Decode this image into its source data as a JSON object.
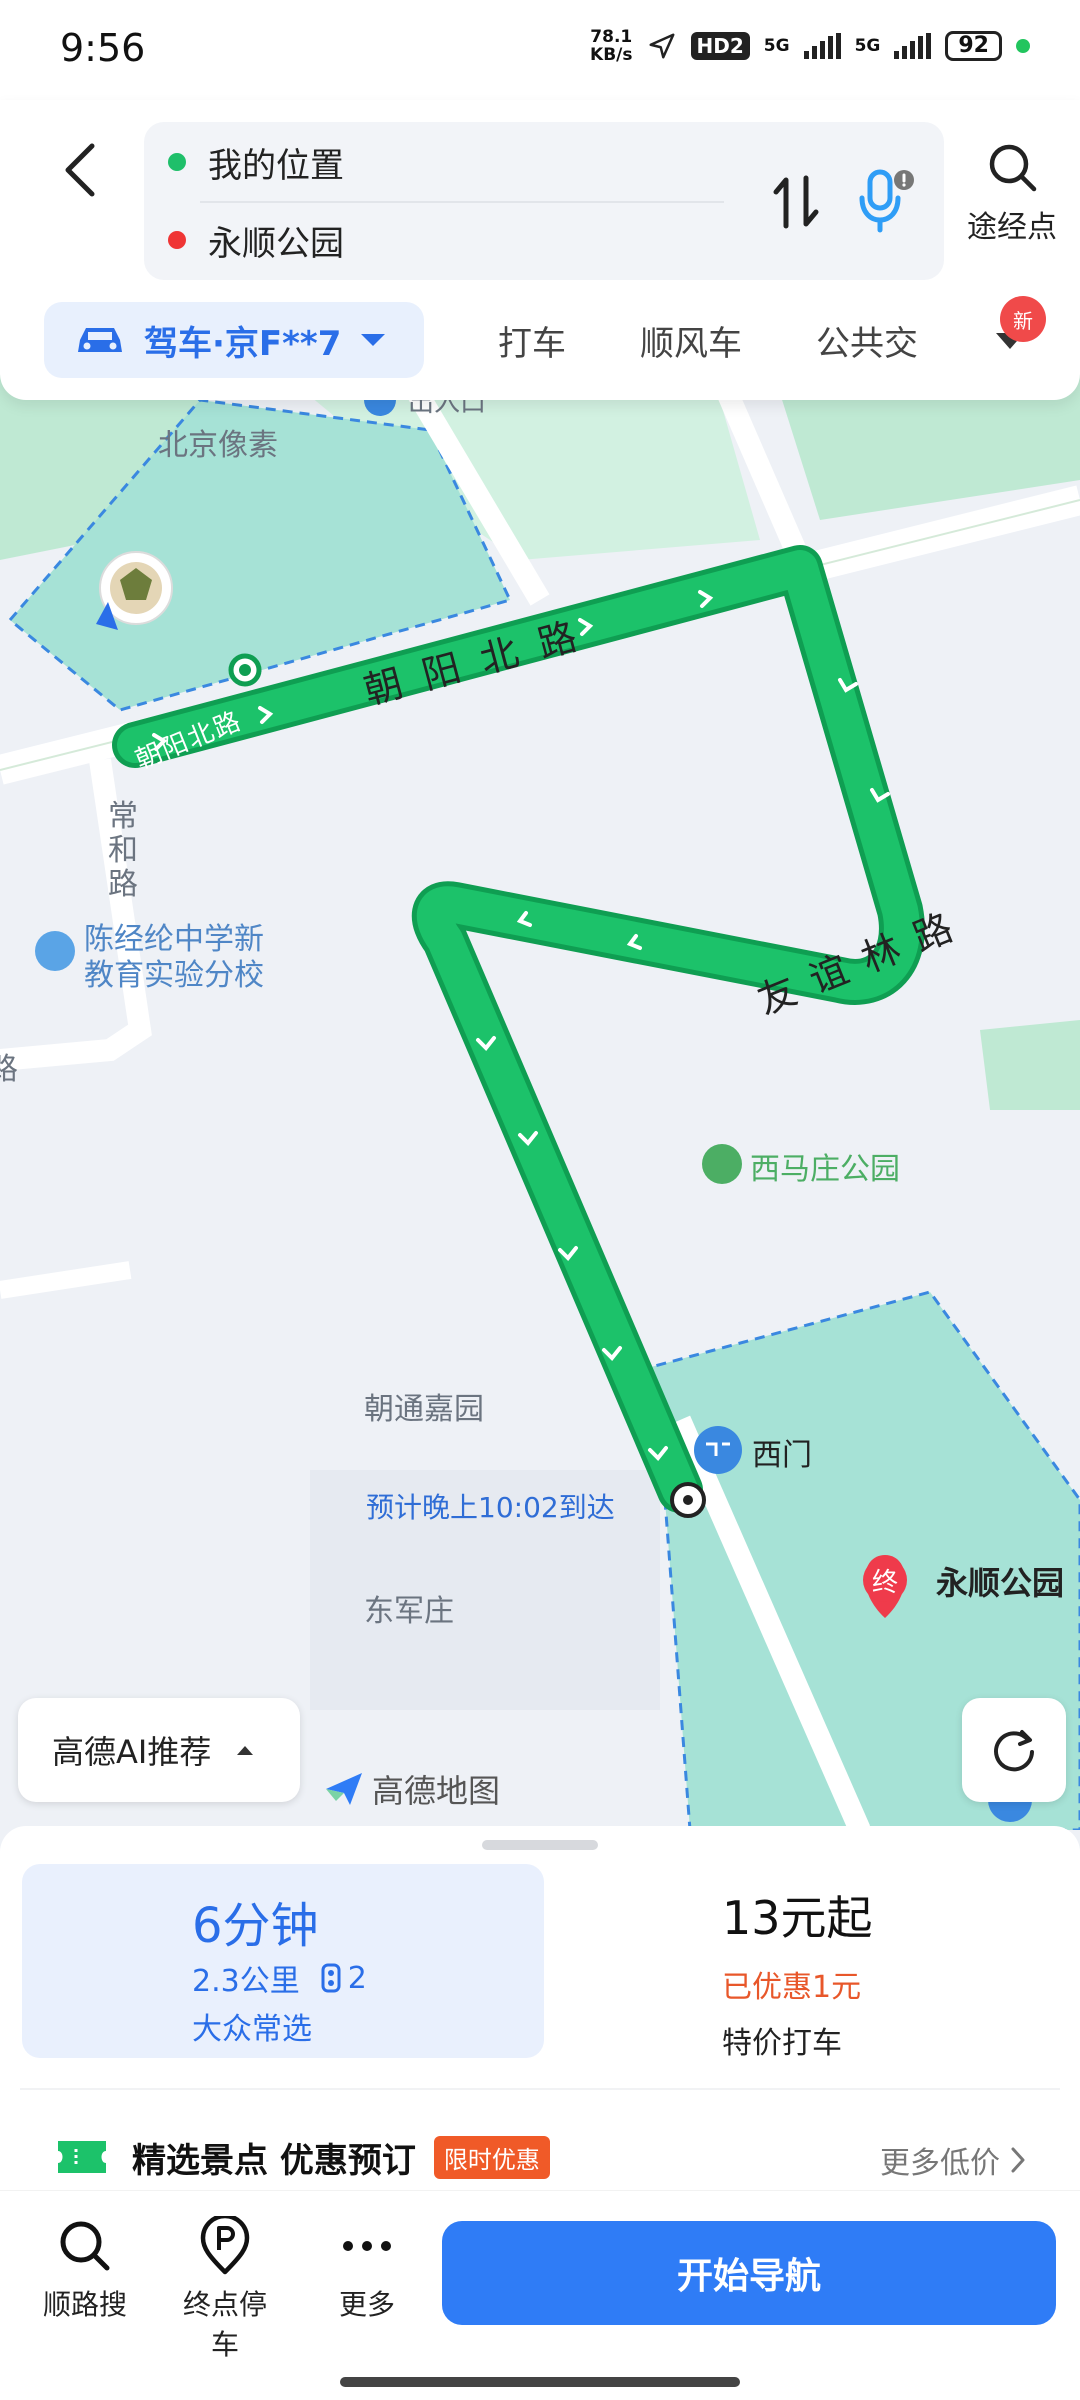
{
  "status_bar": {
    "time": "9:56",
    "net_speed_value": "78.1",
    "net_speed_unit": "KB/s",
    "hd_label": "HD2",
    "sim1": "5G",
    "sim2": "5G",
    "battery": "92"
  },
  "route": {
    "from": "我的位置",
    "to": "永顺公园",
    "via_label": "途经点"
  },
  "modes": {
    "active": "驾车·京F**7",
    "tabs": [
      "打车",
      "顺风车",
      "公共交"
    ],
    "new_badge": "新"
  },
  "map": {
    "labels": {
      "beijing_pixel": "北京像素",
      "chaoyang_north_small": "朝阳北路",
      "chaoyang_north_road": "朝阳北路",
      "youyilin_road": "友谊林路",
      "changhe_road": "常和路",
      "school": "陈经纶中学新教育实验分校",
      "school_line1": "陈经纶中学新",
      "school_line2": "教育实验分校",
      "ximazhuang_park": "西马庄公园",
      "chaotong_jiayuan": "朝通嘉园",
      "dongjunzhuang": "东军庄",
      "west_gate": "西门",
      "destination": "永顺公园",
      "end_marker": "终",
      "exit_partial": "出入口",
      "edge_road": "路"
    },
    "eta": "预计晚上10:02到达",
    "ai_button": "高德AI推荐",
    "logo": "高德地图"
  },
  "summary": {
    "duration": "6分钟",
    "distance": "2.3公里",
    "traffic_lights": "2",
    "tag": "大众常选",
    "taxi_price": "13元起",
    "taxi_discount": "已优惠1元",
    "taxi_label": "特价打车"
  },
  "promo": {
    "title": "精选景点 优惠预订",
    "badge": "限时优惠",
    "more": "更多低价"
  },
  "bottom_bar": {
    "search_along": "顺路搜",
    "parking": "终点停车",
    "more": "更多",
    "start": "开始导航"
  },
  "colors": {
    "route_green": "#1cc26a",
    "accent_blue": "#2f7cf6",
    "park_teal": "#a6e2d6"
  }
}
